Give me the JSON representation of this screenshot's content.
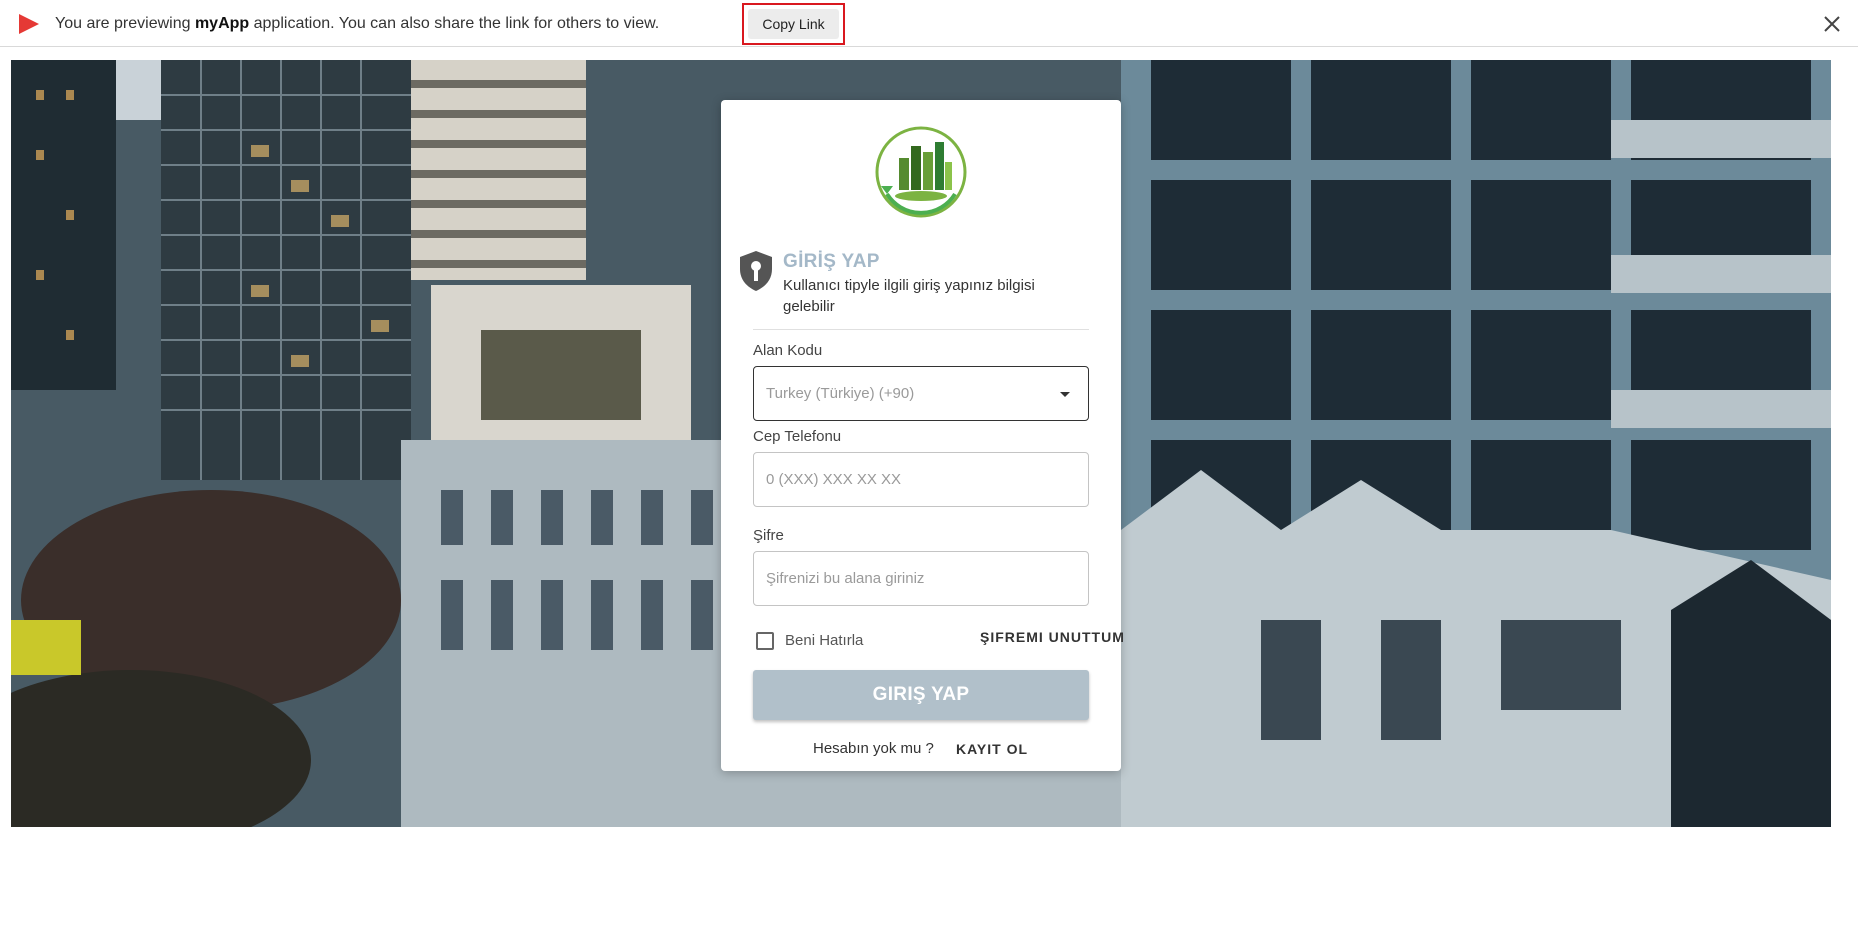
{
  "preview_bar": {
    "text_before": "You are previewing ",
    "app_name": "myApp",
    "text_after": " application. You can also share the link for others to view.",
    "copy_button_label": "Copy Link",
    "accent_color": "#e53935",
    "highlight_color": "#d9181f"
  },
  "login": {
    "title": "GİRİŞ YAP",
    "subtitle": "Kullanıcı tipyle ilgili giriş yapınız bilgisi gelebilir",
    "area_code": {
      "label": "Alan Kodu",
      "value": "Turkey (Türkiye) (+90)"
    },
    "phone": {
      "label": "Cep Telefonu",
      "placeholder": "0 (XXX) XXX XX XX"
    },
    "password": {
      "label": "Şifre",
      "placeholder": "Şifrenizi bu alana giriniz"
    },
    "remember_me": "Beni Hatırla",
    "forgot_password": "ŞIFREMI UNUTTUM",
    "submit_label": "GIRIŞ YAP",
    "no_account_text": "Hesabın yok mu ?",
    "register_label": "KAYIT OL",
    "title_color": "#a4b8c8",
    "button_color": "#b1c0ca"
  }
}
